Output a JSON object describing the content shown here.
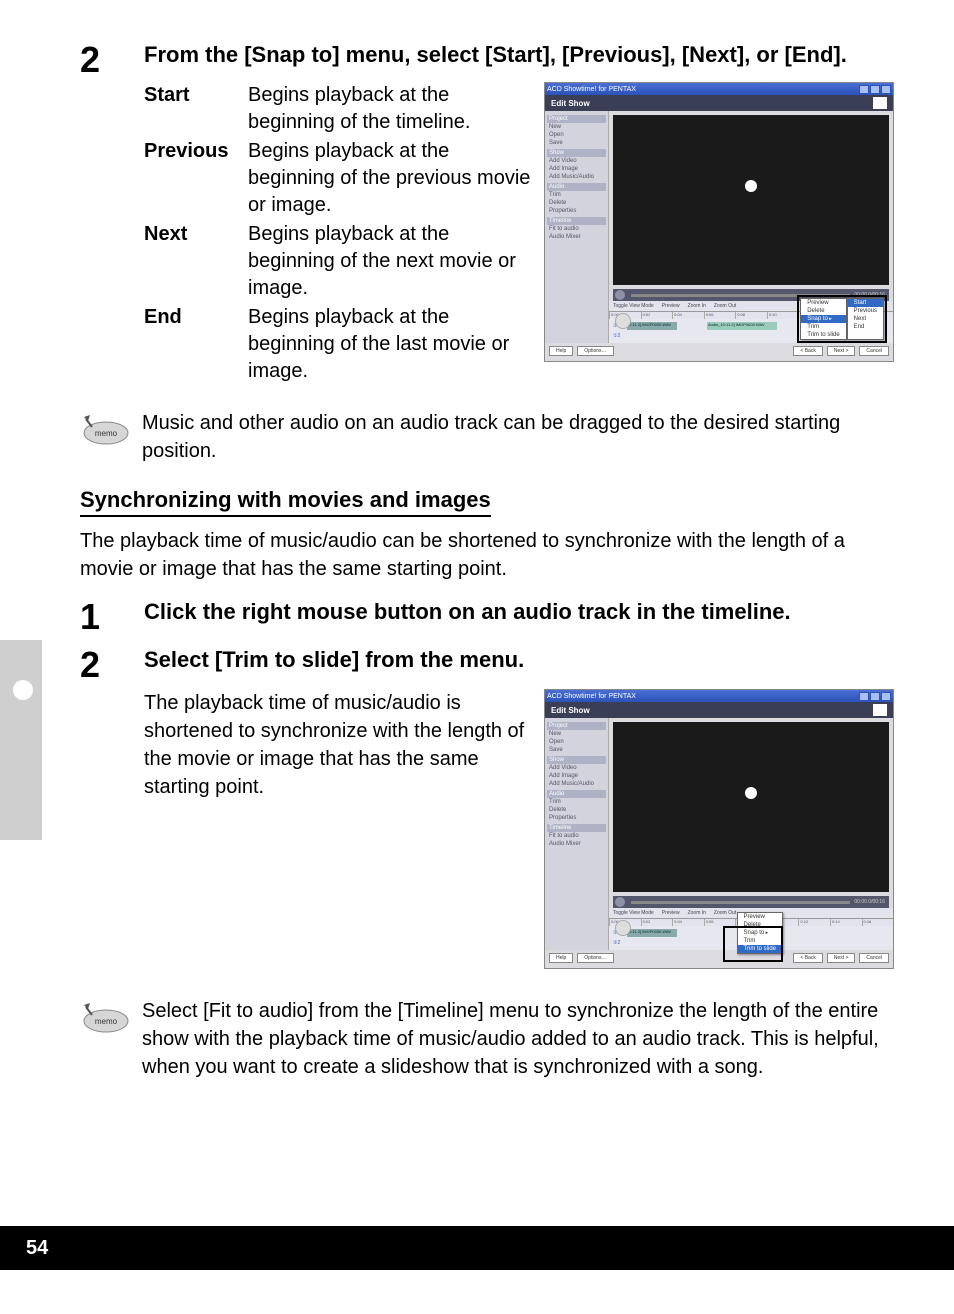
{
  "page_number": "54",
  "step2": {
    "num": "2",
    "text": "From the [Snap to] menu, select [Start], [Previous], [Next], or [End]."
  },
  "defs": [
    {
      "term": "Start",
      "desc": "Begins playback at the beginning of the timeline."
    },
    {
      "term": "Previous",
      "desc": "Begins playback at the beginning of the previous movie or image."
    },
    {
      "term": "Next",
      "desc": "Begins playback at the beginning of the next movie or image."
    },
    {
      "term": "End",
      "desc": "Begins playback at the beginning of the last movie or image."
    }
  ],
  "memo1": "Music and other audio on an audio track can be dragged to the desired starting position.",
  "section_heading": "Synchronizing with movies and images",
  "section_intro": "The playback time of music/audio can be shortened to synchronize with the length of a movie or image that has the same starting point.",
  "sync_step1": {
    "num": "1",
    "text": "Click the right mouse button on an audio track in the timeline."
  },
  "sync_step2": {
    "num": "2",
    "text": "Select [Trim to slide] from the menu."
  },
  "sync_result": "The playback time of music/audio is shortened to synchronize with the length of the movie or image that has the same starting point.",
  "memo2": "Select [Fit to audio] from the [Timeline] menu to synchronize the length of the entire show with the playback time of music/audio added to an audio track. This is helpful, when you want to create a slideshow that is synchronized with a song.",
  "memo_label": "memo",
  "app": {
    "title": "ACD Showtime! for PENTAX",
    "subtitle": "Edit Show",
    "sidebar": {
      "g_project": "Project",
      "i_new": "New",
      "i_open": "Open",
      "i_save": "Save",
      "g_show": "Show",
      "i_addvideo": "Add Video",
      "i_addimage": "Add Image",
      "i_addmusic": "Add Music/Audio",
      "g_audio": "Audio",
      "i_trim": "Trim",
      "i_delete": "Delete",
      "i_props": "Properties",
      "g_timeline": "Timeline",
      "i_fit": "Fit to audio",
      "i_mixer": "Audio Mixer"
    },
    "time": "00:00.0/00:16",
    "time2": "00:00.0/00:16",
    "toolbar": {
      "toggle": "Toggle View Mode",
      "preview": "Preview",
      "zin": "Zoom In",
      "zout": "Zoom Out"
    },
    "ticks": [
      "0:00",
      "0:02",
      "0:04",
      "0:06",
      "0:08",
      "0:10",
      "0:12",
      "0:14",
      "0:16"
    ],
    "trackA": "①1",
    "trackB": "①2",
    "clipA": "[0:11.2] IMGP0000.WAV",
    "clipR": "Audio_10:11.2] IMGP0000.WAV",
    "btn_help": "Help",
    "btn_options": "Options…",
    "btn_back": "< Back",
    "btn_next": "Next >",
    "btn_cancel": "Cancel"
  },
  "ctx1": {
    "col1": [
      "Preview",
      "Delete",
      "Snap to",
      "Trim",
      "Trim to slide"
    ],
    "col2": [
      "Start",
      "Previous",
      "Next",
      "End"
    ]
  },
  "ctx2": {
    "col1": [
      "Preview",
      "Delete",
      "Snap to",
      "Trim",
      "Trim to slide"
    ]
  }
}
